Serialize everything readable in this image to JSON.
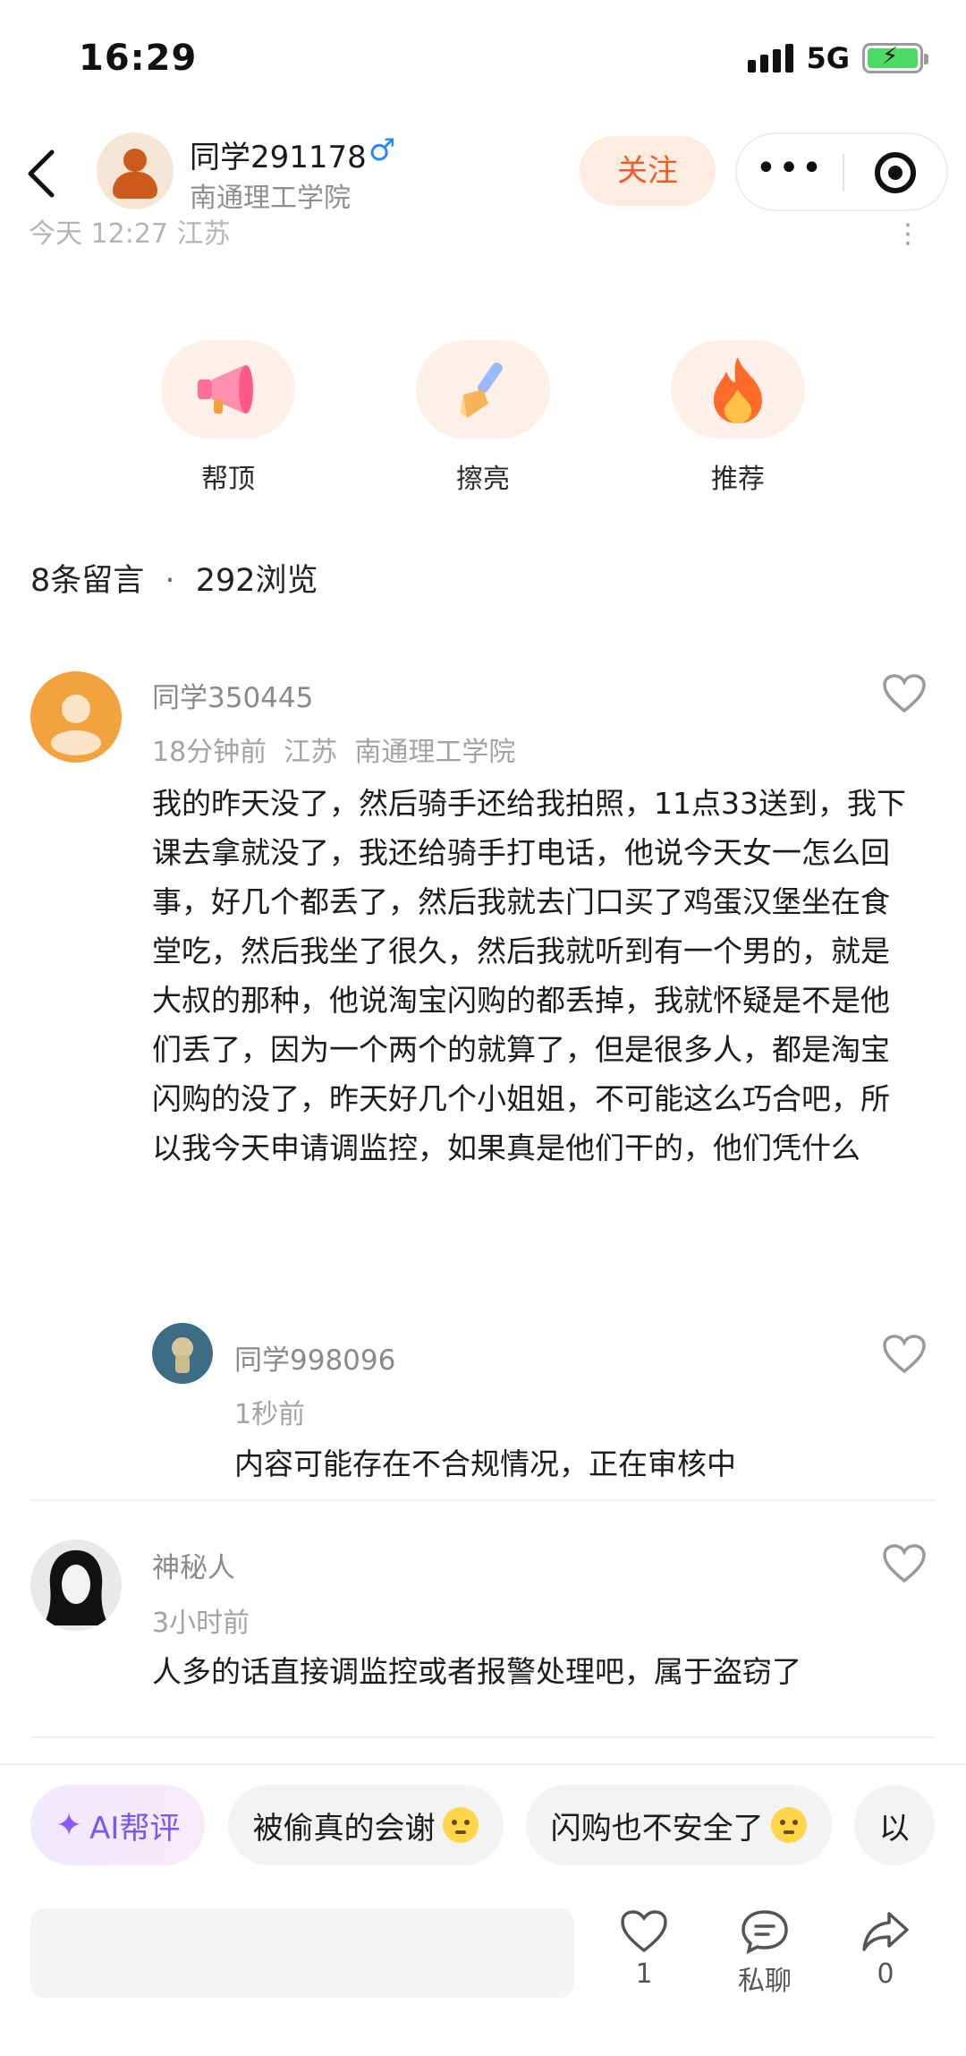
{
  "status_bar": {
    "time": "16:29",
    "network": "5G"
  },
  "header": {
    "user_name": "同学291178",
    "gender_symbol": "♂",
    "school": "南通理工学院",
    "follow_label": "关注",
    "more_label": "•••"
  },
  "post": {
    "time": "今天 12:27",
    "location": "江苏",
    "more_label": "⋮"
  },
  "actions": [
    {
      "label": "帮顶",
      "icon": "megaphone-icon"
    },
    {
      "label": "擦亮",
      "icon": "brush-icon"
    },
    {
      "label": "推荐",
      "icon": "fire-icon"
    }
  ],
  "stats": {
    "comments": "8条留言",
    "dot": "·",
    "views": "292浏览"
  },
  "comments": [
    {
      "name": "同学350445",
      "meta": "18分钟前  江苏  南通理工学院",
      "text": "我的昨天没了，然后骑手还给我拍照，11点33送到，我下课去拿就没了，我还给骑手打电话，他说今天女一怎么回事，好几个都丢了，然后我就去门口买了鸡蛋汉堡坐在食堂吃，然后我坐了很久，然后我就听到有一个男的，就是大叔的那种，他说淘宝闪购的都丢掉，我就怀疑是不是他们丢了，因为一个两个的就算了，但是很多人，都是淘宝闪购的没了，昨天好几个小姐姐，不可能这么巧合吧，所以我今天申请调监控，如果真是他们干的，他们凭什么",
      "reply": {
        "name": "同学998096",
        "meta": "1秒前",
        "text": "内容可能存在不合规情况，正在审核中"
      }
    },
    {
      "name": "神秘人",
      "meta": "3小时前",
      "text": "人多的话直接调监控或者报警处理吧，属于盗窃了"
    }
  ],
  "bottom": {
    "chips": [
      {
        "label": "AI帮评",
        "icon": "sparkle-icon"
      },
      {
        "label": "被偷真的会谢",
        "icon": "emoji-icon"
      },
      {
        "label": "闪购也不安全了",
        "icon": "emoji-icon"
      },
      {
        "label": "以"
      }
    ],
    "like_count": "1",
    "chat_label": "私聊",
    "share_count": "0"
  },
  "colors": {
    "accent": "#f25a2a",
    "ai": "#7b57f5",
    "gender": "#2a86ff"
  }
}
